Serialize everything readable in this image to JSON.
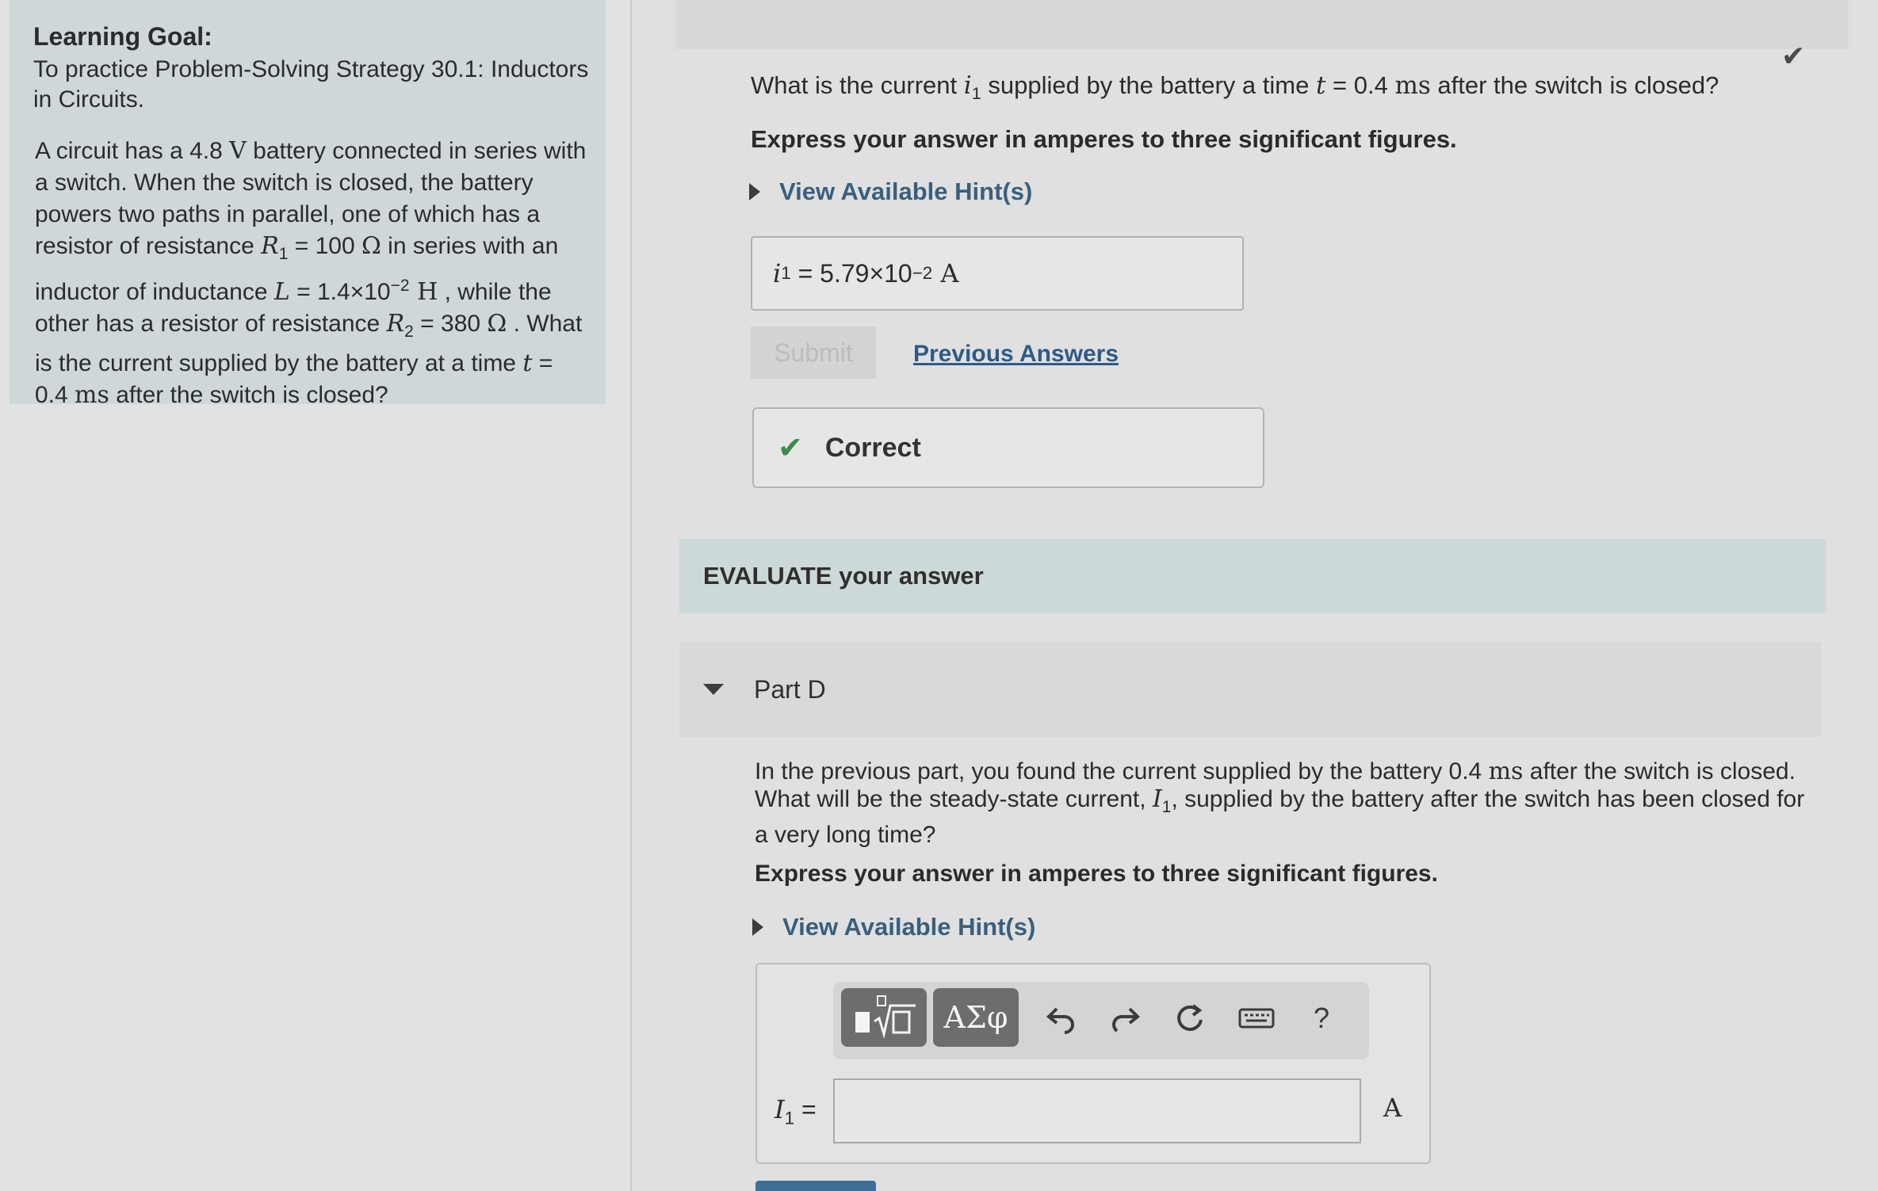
{
  "learning_goal": {
    "title": "Learning Goal:",
    "text": "To practice Problem-Solving Strategy 30.1: Inductors in Circuits.",
    "problem": {
      "p1": "A circuit has a 4.8 ",
      "battery_unit": "V",
      "p2": " battery connected in series with a switch. When the switch is closed, the battery powers two paths in parallel, one of which has a resistor of resistance ",
      "R1_var": "R",
      "R1_sub": "1",
      "R1_value": " = 100 ",
      "ohm": "Ω",
      "p3": " in series with an inductor of inductance ",
      "L_var": "L",
      "L_value": " = 1.4×10",
      "L_exp": "−2",
      "L_unit": " H",
      "p4": " , while the other has a resistor of resistance ",
      "R2_var": "R",
      "R2_sub": "2",
      "R2_value": " = 380 ",
      "p5": " . What is the current supplied by the battery at a time ",
      "t_var": "t",
      "t_value": " = 0.4 ",
      "t_unit": "ms",
      "p6": " after the switch is closed?"
    }
  },
  "part_c": {
    "q1": "What is the current ",
    "i_var": "i",
    "i_sub": "1",
    "q2": " supplied by the battery a time ",
    "t_var": "t",
    "t_value": " = 0.4 ",
    "t_unit": "ms",
    "q3": " after the switch is closed?",
    "instructions": "Express your answer in amperes to three significant figures.",
    "hint_label": "View Available Hint(s)",
    "answer": {
      "var": "i",
      "sub": "1",
      "eq": " = ",
      "value": "5.79×10",
      "exp": "−2",
      "unit": " A"
    },
    "submit_label": "Submit",
    "previous_answers_label": "Previous Answers",
    "feedback": "Correct",
    "completed_icon": "check-icon"
  },
  "evaluate_label": "EVALUATE your answer",
  "part_d": {
    "label": "Part D",
    "q1": "In the previous part, you found the current supplied by the battery 0.4 ",
    "t_unit": "ms",
    "q2": " after the switch is closed. What will be the steady-state current, ",
    "I_var": "I",
    "I_sub": "1",
    "q3": ", supplied by the battery after the switch has been closed for a very long time?",
    "instructions": "Express your answer in amperes to three significant figures.",
    "hint_label": "View Available Hint(s)",
    "toolbar": {
      "greek_label": "ΑΣφ",
      "undo_icon": "undo-icon",
      "redo_icon": "redo-icon",
      "reset_icon": "reset-icon",
      "keyboard_icon": "keyboard-icon",
      "help_label": "?"
    },
    "input": {
      "var": "I",
      "sub": "1",
      "eq": " =",
      "value": "",
      "unit": "A"
    }
  },
  "colors": {
    "goal_bg": "#cfd7d9",
    "evaluate_bg": "#cdd9d8",
    "link": "#2f5a86",
    "correct_green": "#3f8a48",
    "toolbar_btn": "#6d6d6d"
  }
}
